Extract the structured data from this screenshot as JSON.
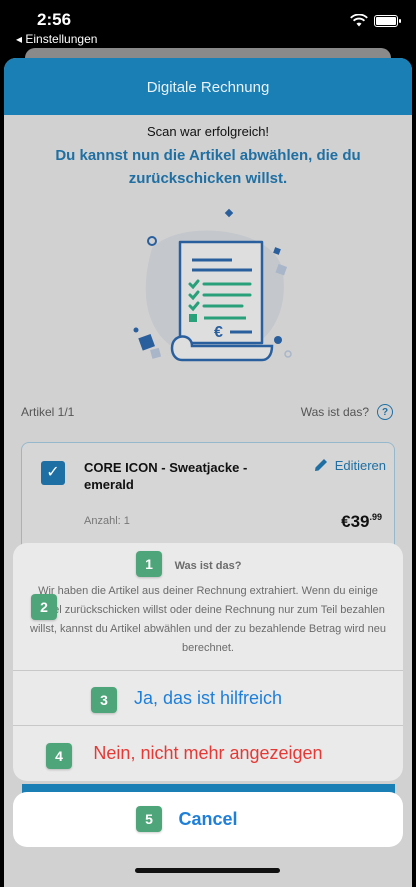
{
  "status_bar": {
    "time": "2:56",
    "back_label": "◂ Einstellungen"
  },
  "header": {
    "title": "Digitale Rechnung"
  },
  "scan": {
    "success": "Scan war erfolgreich!",
    "instruction": "Du kannst nun die Artikel abwählen, die du zurückschicken willst."
  },
  "articles": {
    "counter": "Artikel 1/1",
    "help_label": "Was ist das?",
    "help_icon": "?"
  },
  "item": {
    "checked_icon": "✓",
    "name": "CORE ICON - Sweatjacke - emerald",
    "edit_label": "Editieren",
    "quantity": "Anzahl: 1",
    "price_main": "€39",
    "price_cents": ".99"
  },
  "action_sheet": {
    "title": "Was ist das?",
    "message": "Wir haben die Artikel aus deiner Rechnung extrahiert. Wenn du einige Artikel zurückschicken willst oder deine Rechnung nur zum Teil bezahlen willst, kannst du Artikel abwählen und der zu bezahlende Betrag wird neu berechnet.",
    "option_yes": "Ja, das ist hilfreich",
    "option_no": "Nein, nicht mehr angezeigen",
    "cancel": "Cancel"
  },
  "badges": [
    "1",
    "2",
    "3",
    "4",
    "5"
  ],
  "colors": {
    "accent": "#1e6fa3",
    "header": "#1a7fb4",
    "ios_blue": "#1e7fd9",
    "destructive": "#e53935",
    "badge": "#4fa57a"
  }
}
